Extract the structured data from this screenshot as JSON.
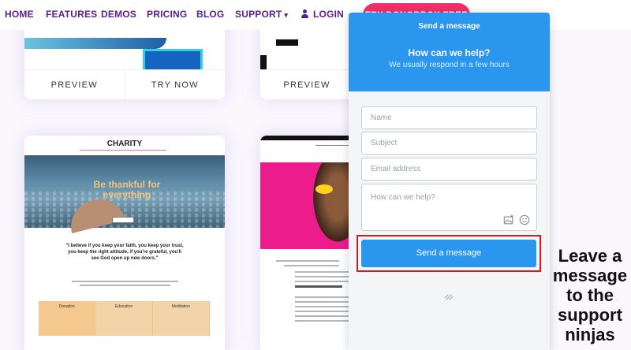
{
  "nav": {
    "items": [
      {
        "label": "HOME"
      },
      {
        "label": "FEATURES"
      },
      {
        "label": "DEMOS"
      },
      {
        "label": "PRICING"
      },
      {
        "label": "BLOG"
      },
      {
        "label": "SUPPORT",
        "icon": "chevron-down-icon"
      },
      {
        "label": "LOGIN",
        "icon": "user-icon"
      }
    ],
    "cta_label": "TRY DONORBOX FREE"
  },
  "cards": [
    {
      "actions": [
        "PREVIEW",
        "TRY NOW"
      ]
    },
    {
      "actions": [
        "PREVIEW"
      ]
    },
    {
      "site_title": "CHARITY",
      "hero_text": "Be thankful for everything",
      "quote": "\"I believe if you keep your faith, you keep your trust, you keep the right attitude, if you're grateful, you'll see God open up new doors.\"",
      "columns": [
        "Donation",
        "Education",
        "Meditation"
      ]
    },
    {}
  ],
  "chat": {
    "title": "Send a message",
    "heading": "How can we help?",
    "subheading": "We usually respond in a few hours",
    "name_placeholder": "Name",
    "subject_placeholder": "Subject",
    "email_placeholder": "Email address",
    "message_placeholder": "How can we help?",
    "send_label": "Send a message",
    "accent_color": "#2a96ee"
  },
  "annotation": {
    "text": "Leave a message to the support ninjas",
    "highlight_color": "#e0151c"
  }
}
